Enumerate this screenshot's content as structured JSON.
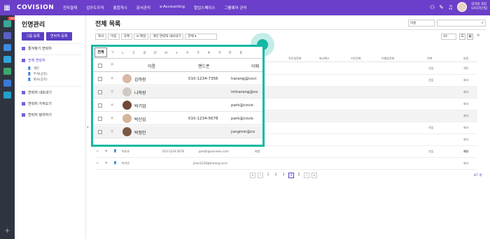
{
  "topbar": {
    "logo": "COVISION",
    "menu": [
      "전자결재",
      "업무도우미",
      "통합게시",
      "문서관리",
      "e-Accounting",
      "협업스페이스",
      "그룹웨어 관리"
    ],
    "user_name": "김하랑 과장",
    "user_dept": "UX디자인팀"
  },
  "sidebar": {
    "badge": "189",
    "title": "인명관리",
    "btn_group": "그룹 등록",
    "btn_contact": "연락처 등록",
    "favorites": "즐겨찾기 연락처",
    "all_contacts": "전체 연락처",
    "sub_personal": "개인",
    "sub_dept": "부서(공유)",
    "sub_company": "회사(공유)",
    "export": "연락처 내보내기",
    "import": "연락처 가져오기",
    "organize": "연락처 정리하기"
  },
  "main": {
    "title": "전체 목록",
    "sort_select": "이름",
    "toolbar": [
      "복사",
      "이동",
      "삭제",
      "메일",
      "개인 연락처 내보내기",
      "전체"
    ],
    "page_size": "10",
    "bg_headers": {
      "fax": "직무설전화",
      "cofax": "회사팩스",
      "other": "기타전화",
      "mobile2": "이메일전화",
      "title": "직책",
      "cat": "분류"
    },
    "bg_rows": [
      {
        "title": "선임",
        "cat": "개인"
      },
      {
        "title": "선임",
        "cat": "회사"
      },
      {
        "title": "",
        "cat": "회사"
      },
      {
        "title": "",
        "cat": "회사"
      },
      {
        "title": "",
        "cat": "회사"
      },
      {
        "title": "선임",
        "cat": "회사"
      },
      {
        "title": "",
        "cat": "회사"
      },
      {
        "title": "선임",
        "cat": "개인"
      }
    ],
    "bg_extra_rows": [
      {
        "name": "박효호",
        "phone": "010-1234-5678",
        "email": "parkjh@covision.com",
        "company": "회원",
        "cat": "회사"
      },
      {
        "name": "박지빈",
        "phone": "",
        "email": "jieun1234@harang.co.kr",
        "company": "",
        "cat": "회사"
      }
    ],
    "pages": [
      "«",
      "‹",
      "1",
      "2",
      "3",
      "4",
      "5",
      "›",
      "»"
    ],
    "active_page": "4",
    "total": "87 개"
  },
  "overlay": {
    "index_tabs": [
      "전체",
      "ㄱ",
      "ㄴ",
      "ㄷ",
      "ㄹ",
      "ㅁ",
      "ㅂ",
      "ㅅ",
      "ㅇ",
      "ㅈ",
      "ㅊ",
      "ㅋ",
      "ㅌ",
      "ㅍ"
    ],
    "col_name": "이름",
    "col_phone": "핸드폰",
    "col_email": "이메",
    "rows": [
      {
        "name": "김하랑",
        "phone": "010-1234-7356",
        "email": "harang@covi"
      },
      {
        "name": "나하랑",
        "phone": "",
        "email": "imharang@co"
      },
      {
        "name": "박기업",
        "phone": "",
        "email": "park@covis"
      },
      {
        "name": "박신입",
        "phone": "010-1234-5678",
        "email": "park@covis"
      },
      {
        "name": "박정인",
        "phone": "",
        "email": "jungmin@co"
      }
    ]
  },
  "colors": {
    "brand": "#6b3fc9",
    "highlight": "#15b8a3"
  }
}
